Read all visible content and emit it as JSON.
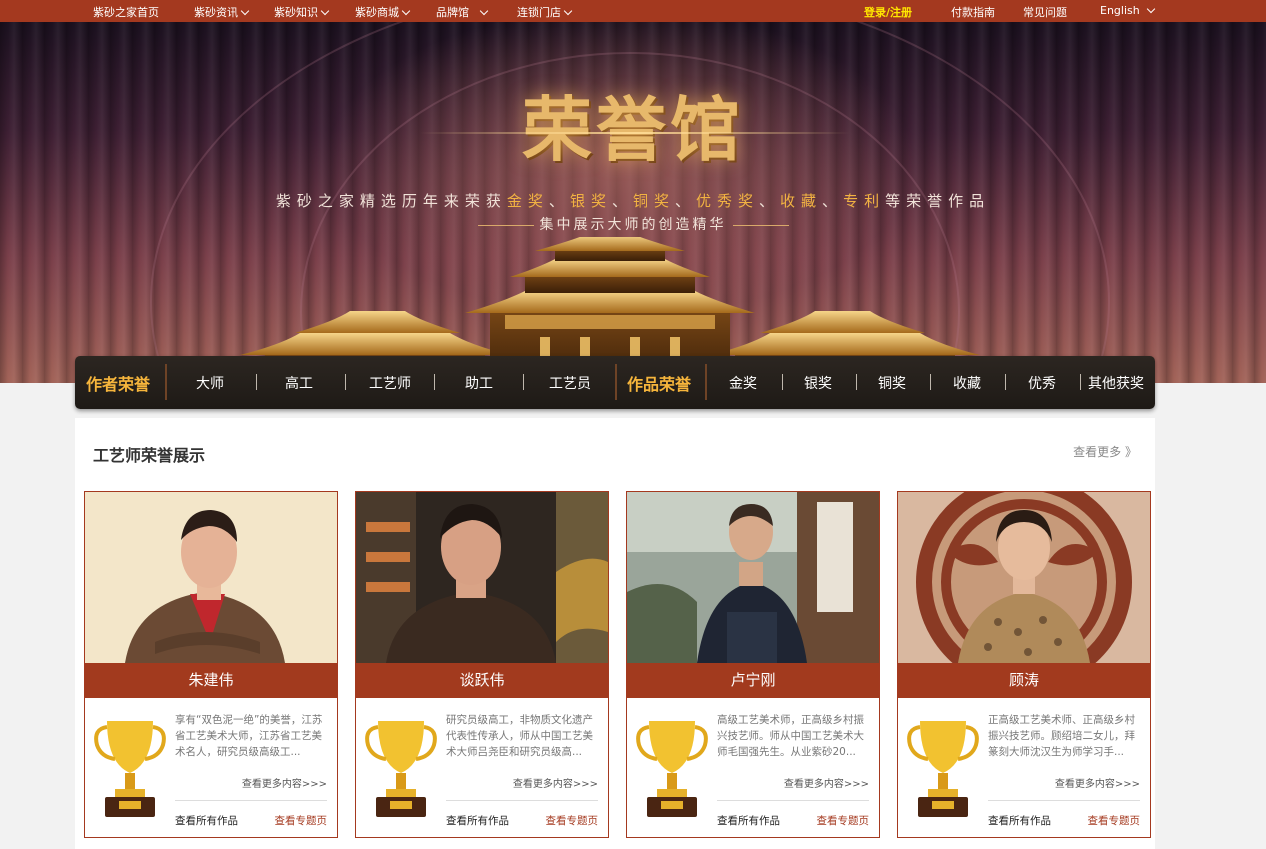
{
  "topbar": {
    "home": "紫砂之家首页",
    "news": "紫砂资讯",
    "knowledge": "紫砂知识",
    "mall": "紫砂商城",
    "brand": "品牌馆",
    "stores": "连锁门店",
    "login": "登录/注册",
    "payment": "付款指南",
    "faq": "常见问题",
    "language": "English"
  },
  "banner": {
    "title": "荣誉馆",
    "sub_prefix": "紫砂之家精选历年来荣获",
    "sub_awards": [
      "金奖",
      "银奖",
      "铜奖",
      "优秀奖",
      "收藏",
      "专利"
    ],
    "sub_separator": "、",
    "sub_suffix": "等荣誉作品",
    "sub2": "集中展示大师的创造精华"
  },
  "nav": {
    "author_head": "作者荣誉",
    "author_items": [
      "大师",
      "高工",
      "工艺师",
      "助工",
      "工艺员"
    ],
    "works_head": "作品荣誉",
    "works_items": [
      "金奖",
      "银奖",
      "铜奖",
      "收藏",
      "优秀",
      "其他获奖"
    ]
  },
  "section": {
    "title": "工艺师荣誉展示",
    "more": "查看更多 》"
  },
  "cards": [
    {
      "name": "朱建伟",
      "desc": "享有“双色泥一绝”的美誉，江苏省工艺美术大师，江苏省工艺美术名人，研究员级高级工...",
      "more": "查看更多内容>>>",
      "all_works": "查看所有作品",
      "special": "查看专题页"
    },
    {
      "name": "谈跃伟",
      "desc": "研究员级高工，非物质文化遗产代表性传承人，师从中国工艺美术大师吕尧臣和研究员级高...",
      "more": "查看更多内容>>>",
      "all_works": "查看所有作品",
      "special": "查看专题页"
    },
    {
      "name": "卢宁刚",
      "desc": "高级工艺美术师，正高级乡村振兴技艺师。师从中国工艺美术大师毛国强先生。从业紫砂20...",
      "more": "查看更多内容>>>",
      "all_works": "查看所有作品",
      "special": "查看专题页"
    },
    {
      "name": "顾涛",
      "desc": "正高级工艺美术师、正高级乡村振兴技艺师。顾绍培二女儿，拜篆刻大师沈汉生为师学习手...",
      "more": "查看更多内容>>>",
      "all_works": "查看所有作品",
      "special": "查看专题页"
    }
  ],
  "colors": {
    "brand": "#a4391f",
    "gold": "#f6b53c",
    "nav_bg": "#231e1a"
  }
}
